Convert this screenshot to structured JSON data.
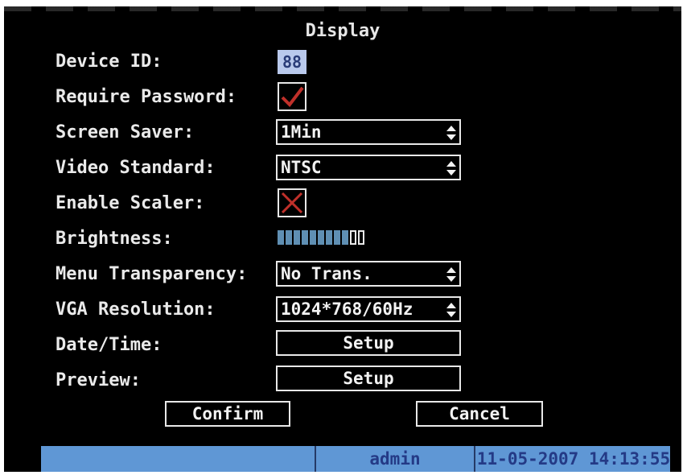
{
  "title": "Display",
  "device_id": {
    "label": "Device ID:",
    "value": "88"
  },
  "require_password": {
    "label": "Require Password:",
    "checked": true
  },
  "screen_saver": {
    "label": "Screen Saver:",
    "value": "1Min"
  },
  "video_standard": {
    "label": "Video Standard:",
    "value": "NTSC"
  },
  "enable_scaler": {
    "label": "Enable Scaler:",
    "checked": false
  },
  "brightness": {
    "label": "Brightness:",
    "level": 9,
    "max": 11
  },
  "menu_transparency": {
    "label": "Menu Transparency:",
    "value": "No Trans."
  },
  "vga_resolution": {
    "label": "VGA Resolution:",
    "value": "1024*768/60Hz"
  },
  "date_time": {
    "label": "Date/Time:",
    "button": "Setup"
  },
  "preview": {
    "label": "Preview:",
    "button": "Setup"
  },
  "buttons": {
    "confirm": "Confirm",
    "cancel": "Cancel"
  },
  "status": {
    "user": "admin",
    "datetime": "11-05-2007 14:13:55"
  },
  "colors": {
    "checked_mark": "#c0302a",
    "unchecked_mark": "#c0302a",
    "status_bar": "#5f97d5",
    "brightness_on": "#5f8fb3"
  }
}
